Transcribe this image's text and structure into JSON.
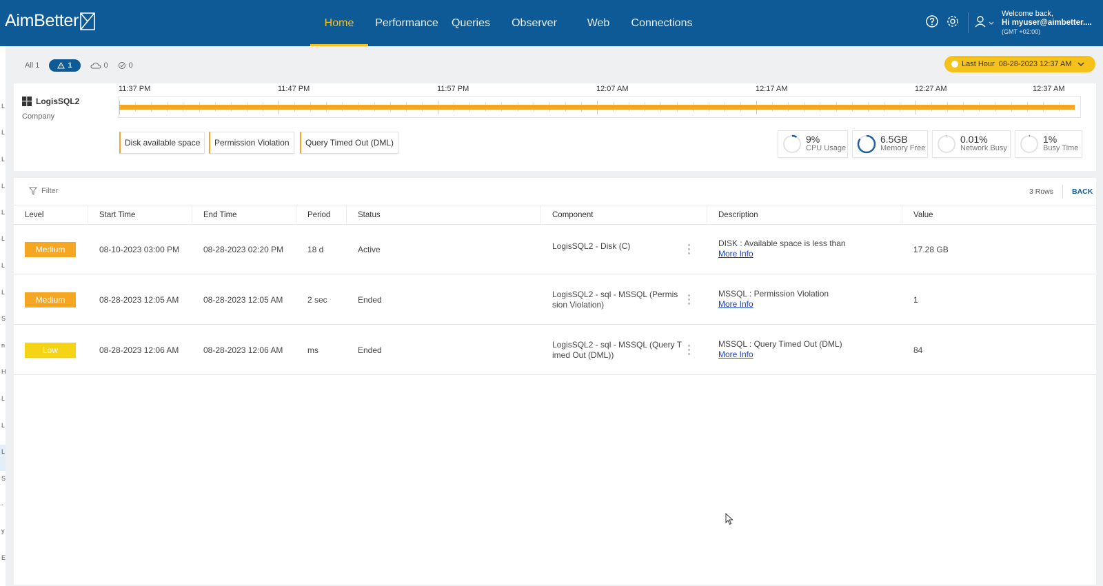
{
  "header": {
    "logo_text": "AimBetter",
    "nav": [
      {
        "label": "Home",
        "active": true
      },
      {
        "label": "Performance",
        "active": false
      },
      {
        "label": "Queries",
        "active": false
      },
      {
        "label": "Observer",
        "active": false
      },
      {
        "label": "Web",
        "active": false
      },
      {
        "label": "Connections",
        "active": false
      }
    ],
    "welcome_line1": "Welcome back,",
    "welcome_line2": "Hi myuser@aimbetter....",
    "welcome_line3": "(GMT +02:00)"
  },
  "left_rail_letters": [
    "L",
    "L",
    "L",
    "L",
    "L",
    "L",
    "L",
    "L",
    "S",
    "n",
    "H",
    "L",
    "L",
    "L",
    "S",
    "-",
    "y",
    "E"
  ],
  "filters": {
    "all_label": "All 1",
    "alert_count": "1",
    "cloud_count": "0",
    "ok_count": "0"
  },
  "time_range": {
    "label": "Last Hour",
    "date": "08-28-2023 12:37 AM"
  },
  "server": {
    "name": "LogisSQL2",
    "company": "Company",
    "timeline_labels": [
      "11:37 PM",
      "11:47 PM",
      "11:57 PM",
      "12:07 AM",
      "12:17 AM",
      "12:27 AM",
      "12:37 AM"
    ],
    "tags": [
      "Disk available space",
      "Permission Violation",
      "Query Timed Out (DML)"
    ],
    "metrics": [
      {
        "value": "9%",
        "label": "CPU Usage",
        "fraction": 0.09
      },
      {
        "value": "6.5GB",
        "label": "Memory Free",
        "fraction": 0.85
      },
      {
        "value": "0.01%",
        "label": "Network Busy",
        "fraction": 0.0
      },
      {
        "value": "1%",
        "label": "Busy Time",
        "fraction": 0.01
      }
    ]
  },
  "table": {
    "filter_label": "Filter",
    "rows_count": "3 Rows",
    "back_label": "BACK",
    "columns": [
      "Level",
      "Start Time",
      "End Time",
      "Period",
      "Status",
      "Component",
      "Description",
      "Value"
    ],
    "rows": [
      {
        "level": "Medium",
        "severity": "medium",
        "start": "08-10-2023 03:00 PM",
        "end": "08-28-2023 02:20 PM",
        "period": "18 d",
        "status": "Active",
        "component": "LogisSQL2 - Disk (C)",
        "description": "DISK : Available space is less than",
        "more": "More Info",
        "value": "17.28 GB"
      },
      {
        "level": "Medium",
        "severity": "medium",
        "start": "08-28-2023 12:05 AM",
        "end": "08-28-2023 12:05 AM",
        "period": "2 sec",
        "status": "Ended",
        "component": "LogisSQL2 - sql - MSSQL (Permis sion Violation)",
        "description": "MSSQL : Permission Violation",
        "more": "More Info",
        "value": "1"
      },
      {
        "level": "Low",
        "severity": "low",
        "start": "08-28-2023 12:06 AM",
        "end": "08-28-2023 12:06 AM",
        "period": "ms",
        "status": "Ended",
        "component": "LogisSQL2 - sql - MSSQL (Query T imed Out (DML))",
        "description": "MSSQL : Query Timed Out (DML)",
        "more": "More Info",
        "value": "84"
      }
    ]
  }
}
